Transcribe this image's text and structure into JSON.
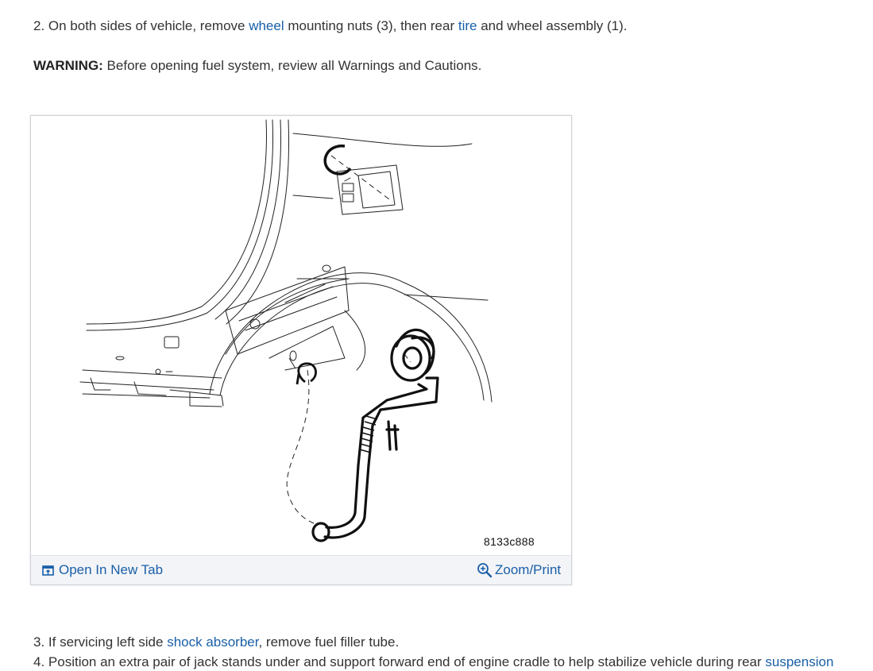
{
  "step2": {
    "prefix": "2. On both sides of vehicle, remove ",
    "link_wheel": "wheel",
    "middle": " mounting nuts (3), then rear ",
    "link_tire": "tire",
    "suffix": " and wheel assembly (1)."
  },
  "warning": {
    "label": "WARNING:",
    "text": " Before opening fuel system, review all Warnings and Cautions."
  },
  "figure": {
    "code": "8133c888",
    "open_tab_label": "Open In New Tab",
    "zoom_label": "Zoom/Print",
    "icons": [
      "open-new-tab-icon",
      "zoom-icon"
    ]
  },
  "step3": {
    "prefix": "3. If servicing left side ",
    "link_shock": "shock absorber",
    "suffix": ", remove fuel filler tube."
  },
  "step4": {
    "prefix": "4. Position an extra pair of jack stands under and support forward end of engine cradle to help stabilize vehicle during rear ",
    "link_suspension": "suspension"
  },
  "colors": {
    "link": "#1a5fa8",
    "text": "#333333",
    "toolbar_bg": "#f3f4f7"
  }
}
